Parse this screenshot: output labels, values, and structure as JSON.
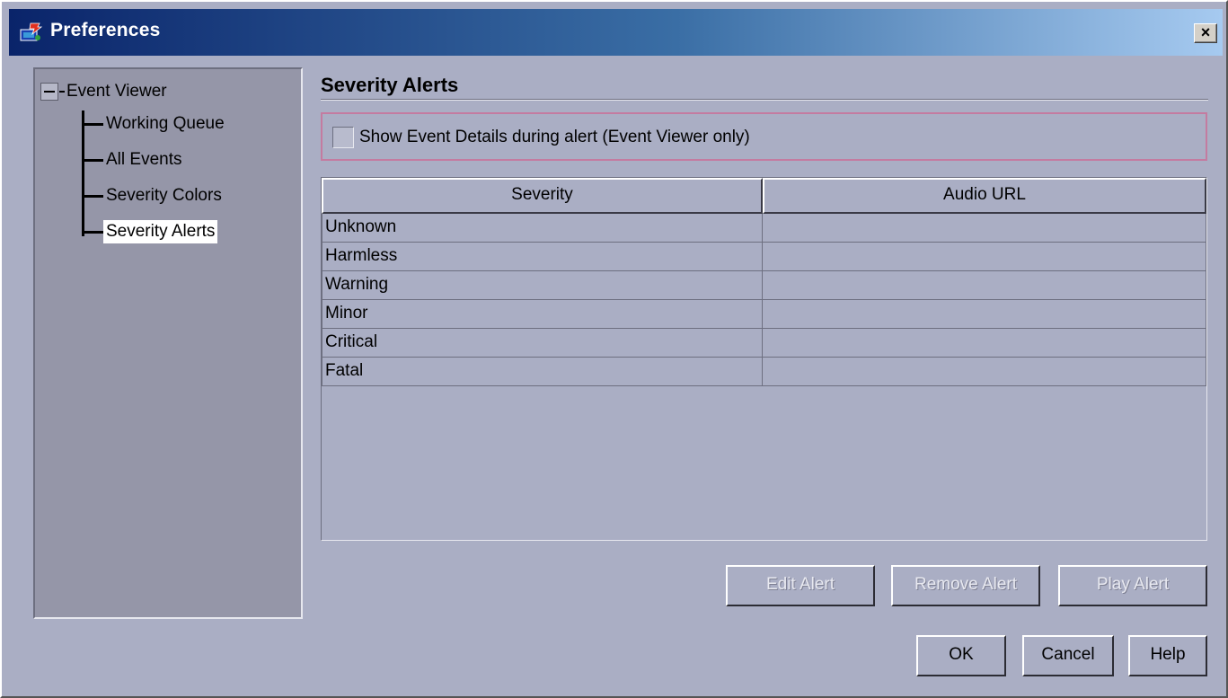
{
  "window": {
    "title": "Preferences",
    "close_label": "×"
  },
  "tree": {
    "root": "Event Viewer",
    "children": [
      "Working Queue",
      "All Events",
      "Severity Colors",
      "Severity Alerts"
    ],
    "selected": "Severity Alerts"
  },
  "section": {
    "title": "Severity Alerts"
  },
  "option": {
    "show_details_label": "Show Event Details during alert (Event Viewer only)",
    "show_details_checked": false
  },
  "table": {
    "columns": [
      "Severity",
      "Audio URL"
    ],
    "rows": [
      {
        "severity": "Unknown",
        "audio_url": ""
      },
      {
        "severity": "Harmless",
        "audio_url": ""
      },
      {
        "severity": "Warning",
        "audio_url": ""
      },
      {
        "severity": "Minor",
        "audio_url": ""
      },
      {
        "severity": "Critical",
        "audio_url": ""
      },
      {
        "severity": "Fatal",
        "audio_url": ""
      }
    ]
  },
  "alert_buttons": {
    "edit": "Edit Alert",
    "remove": "Remove Alert",
    "play": "Play Alert"
  },
  "dialog_buttons": {
    "ok": "OK",
    "cancel": "Cancel",
    "help": "Help"
  },
  "colors": {
    "titlebar_start": "#0a246a",
    "titlebar_end": "#a6caf0",
    "window_bg": "#aaaec4",
    "tree_bg": "#9596a8",
    "group_border": "#c47ba0"
  }
}
